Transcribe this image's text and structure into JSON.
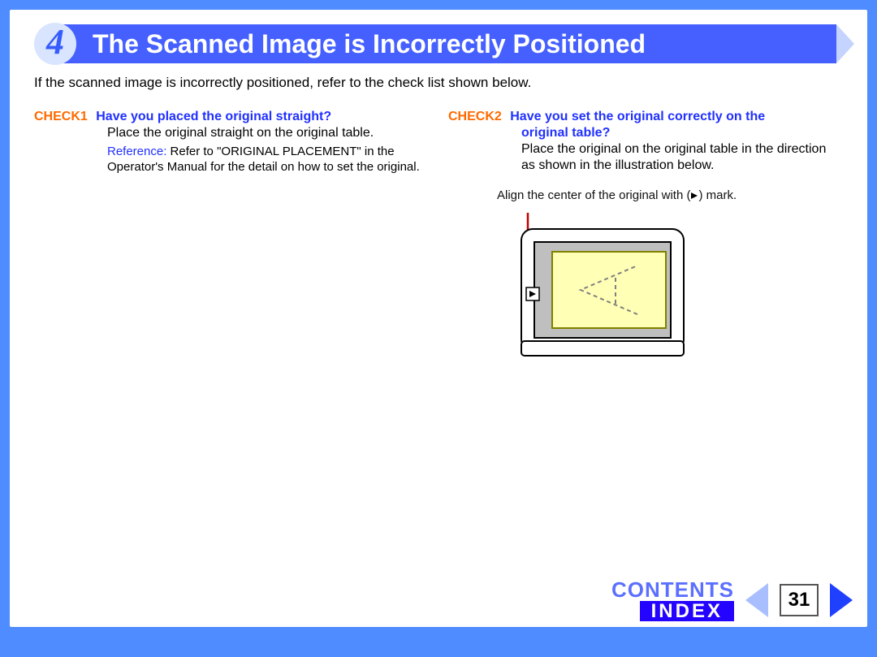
{
  "page_number": "31",
  "header": {
    "section_number": "4",
    "title": "The Scanned Image is Incorrectly Positioned"
  },
  "intro": "If the scanned image is incorrectly positioned, refer to the check list shown below.",
  "check1": {
    "label": "CHECK1",
    "question": "Have you placed the original straight?",
    "answer": "Place the original straight on the original table.",
    "reference_label": "Reference:",
    "reference_text": "Refer to \"ORIGINAL PLACEMENT\" in the Operator's Manual for the detail on how to set the original."
  },
  "check2": {
    "label": "CHECK2",
    "question_line1": "Have you set the original correctly on the",
    "question_line2": "original table?",
    "answer": "Place the original on the original table in the direction as shown in the illustration below.",
    "caption_pre": "Align the center of the original with (",
    "caption_post": ") mark."
  },
  "nav": {
    "contents": "CONTENTS",
    "index": "INDEX"
  }
}
